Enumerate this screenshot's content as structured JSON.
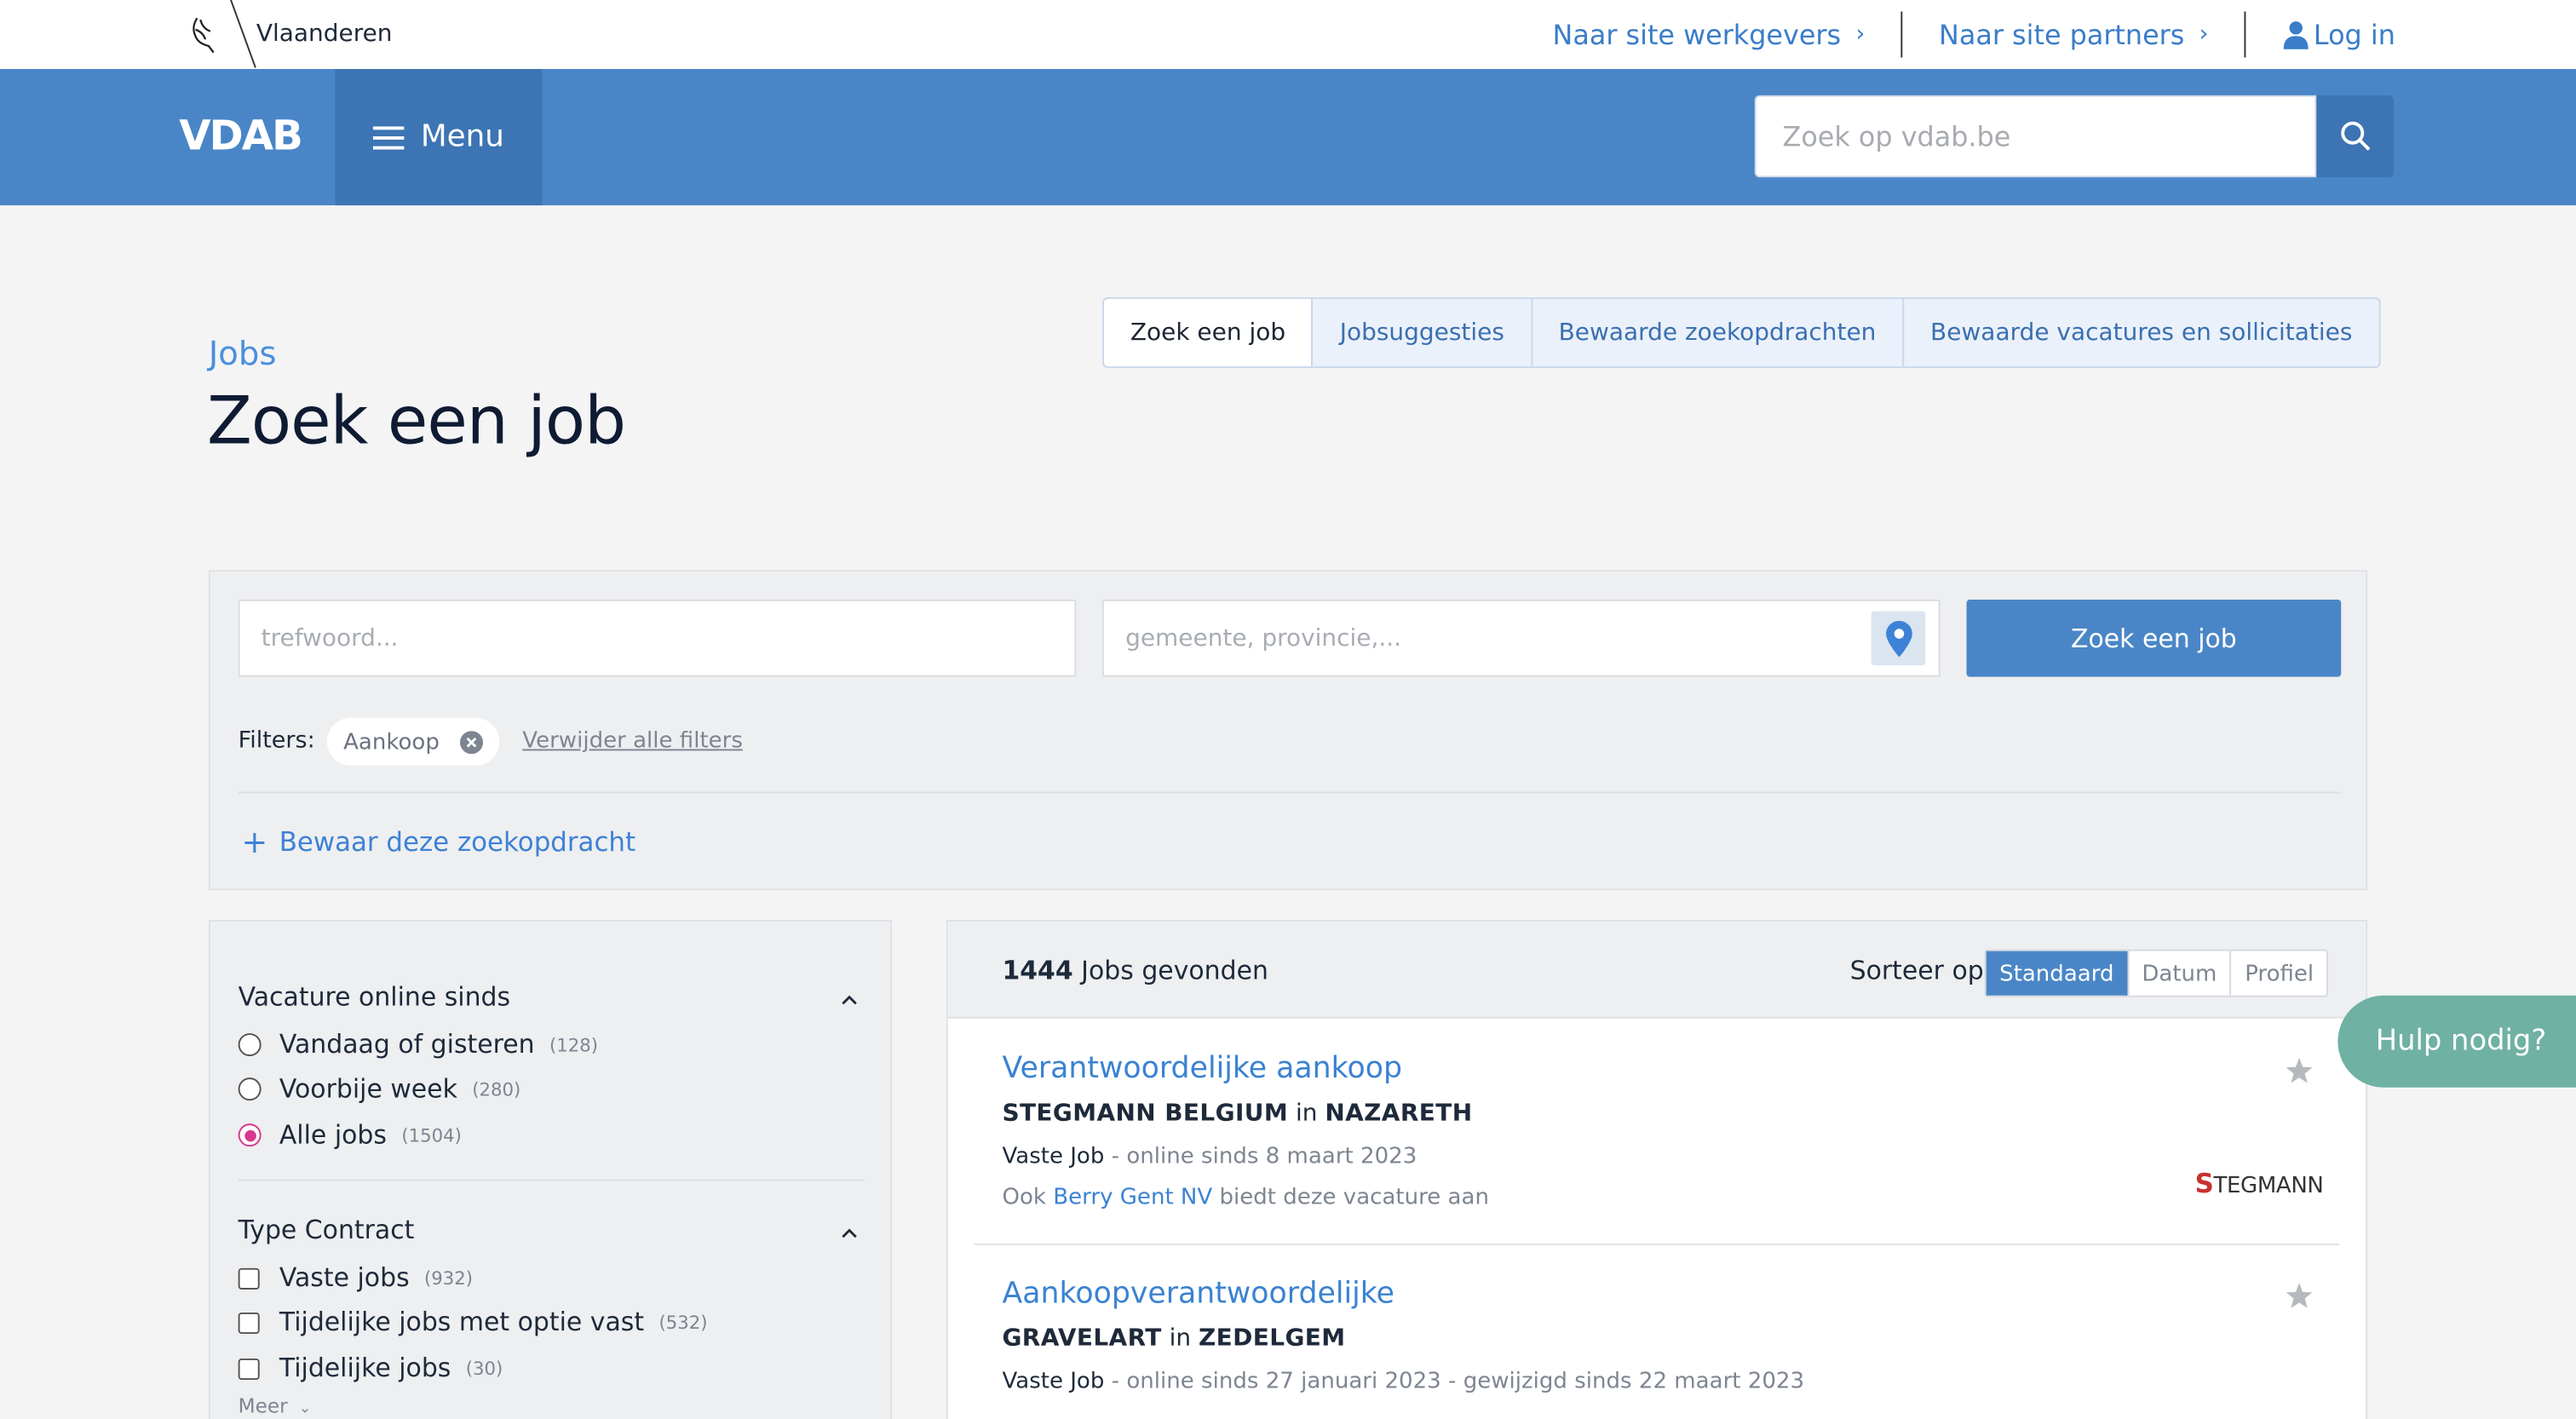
{
  "topbar": {
    "brand": "Vlaanderen",
    "link_employers": "Naar site werkgevers",
    "link_partners": "Naar site partners",
    "login": "Log in"
  },
  "header": {
    "logo": "VDAB",
    "menu": "Menu",
    "search_placeholder": "Zoek op vdab.be"
  },
  "page": {
    "breadcrumb": "Jobs",
    "title": "Zoek een job",
    "tabs": [
      "Zoek een job",
      "Jobsuggesties",
      "Bewaarde zoekopdrachten",
      "Bewaarde vacatures en sollicitaties"
    ]
  },
  "search": {
    "keyword_placeholder": "trefwoord...",
    "location_placeholder": "gemeente, provincie,...",
    "submit": "Zoek een job",
    "filters_label": "Filters:",
    "active_filter": "Aankoop",
    "remove_all": "Verwijder alle filters",
    "save_search": "Bewaar deze zoekopdracht"
  },
  "facets": {
    "online_since": {
      "title": "Vacature online sinds",
      "options": [
        {
          "label": "Vandaag of gisteren",
          "count": "(128)",
          "selected": false
        },
        {
          "label": "Voorbije week",
          "count": "(280)",
          "selected": false
        },
        {
          "label": "Alle jobs",
          "count": "(1504)",
          "selected": true
        }
      ]
    },
    "contract": {
      "title": "Type Contract",
      "options": [
        {
          "label": "Vaste jobs",
          "count": "(932)"
        },
        {
          "label": "Tijdelijke jobs met optie vast",
          "count": "(532)"
        },
        {
          "label": "Tijdelijke jobs",
          "count": "(30)"
        }
      ],
      "more": "Meer"
    }
  },
  "results": {
    "count": "1444",
    "count_suffix": "Jobs gevonden",
    "sort_label": "Sorteer op",
    "sort_options": [
      "Standaard",
      "Datum",
      "Profiel"
    ],
    "jobs": [
      {
        "title": "Verantwoordelijke aankoop",
        "company": "STEGMANN BELGIUM",
        "in": "in",
        "location": "NAZARETH",
        "type": "Vaste Job",
        "meta": " - online sinds 8 maart 2023",
        "also_prefix": "Ook ",
        "also_company": "Berry Gent NV",
        "also_suffix": " biedt deze vacature aan",
        "logo_first": "S",
        "logo_rest": "TEGMANN"
      },
      {
        "title": "Aankoopverantwoordelijke",
        "company": "GRAVELART",
        "in": "in",
        "location": "ZEDELGEM",
        "type": "Vaste Job",
        "meta": " - online sinds 27 januari 2023 - gewijzigd sinds 22 maart 2023"
      }
    ]
  },
  "help": "Hulp nodig?",
  "colors": {
    "brand_blue": "#4a86c7",
    "link_blue": "#3a82d2",
    "help_green": "#6fb1a3",
    "radio_pink": "#d6388f"
  }
}
